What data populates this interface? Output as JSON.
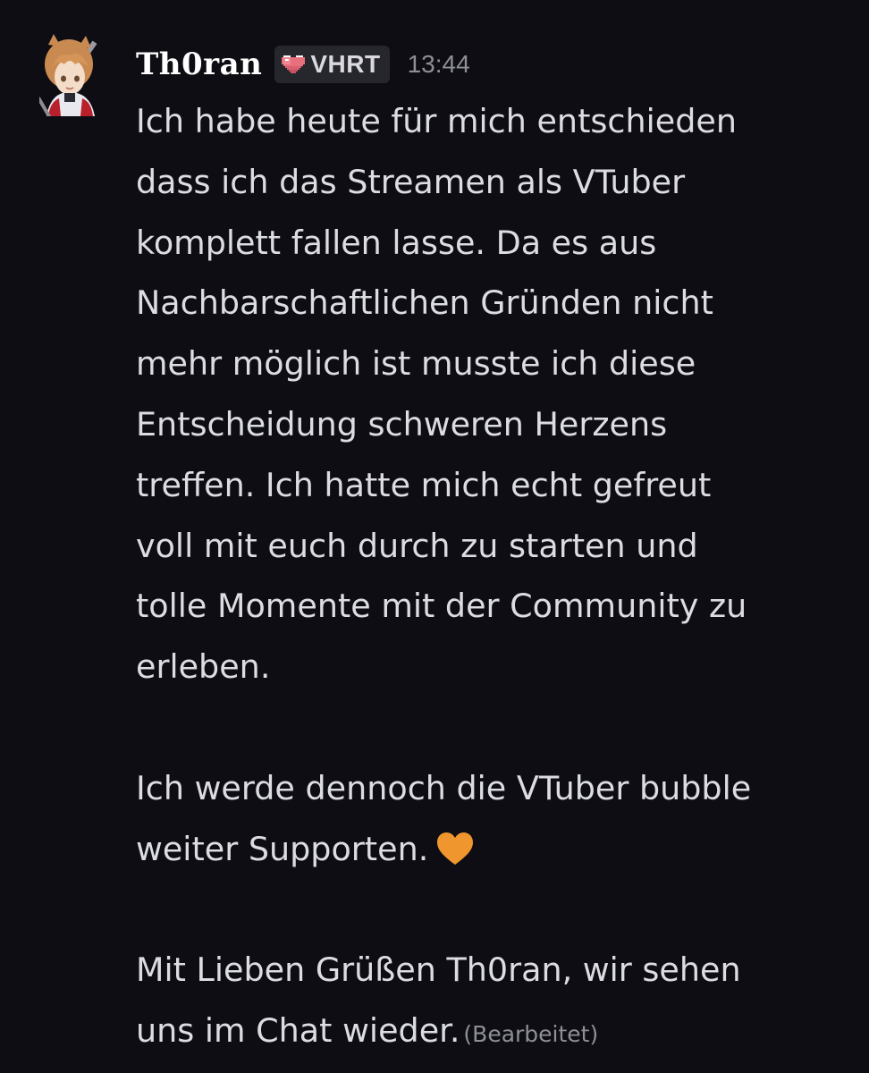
{
  "message": {
    "author": "Th0ran",
    "tag": "VHRT",
    "timestamp": "13:44",
    "paragraphs": [
      {
        "lines": [
          "Ich habe heute für mich entschieden",
          "dass ich das Streamen als VTuber",
          "komplett fallen lasse. Da es aus",
          "Nachbarschaftlichen Gründen nicht",
          "mehr möglich ist musste ich diese",
          "Entscheidung schweren Herzens",
          "treffen. Ich hatte mich echt gefreut",
          "voll mit euch durch zu starten und",
          "tolle Momente mit der Community zu",
          "erleben."
        ]
      },
      {
        "lines": [
          "Ich werde dennoch die VTuber bubble",
          "weiter Supporten."
        ],
        "emoji": "orange-heart"
      },
      {
        "lines": [
          "Mit Lieben Grüßen Th0ran,  wir sehen",
          "uns im Chat wieder."
        ]
      }
    ],
    "edited_label": "(Bearbeitet)"
  },
  "icons": {
    "tag_icon": "pixel-heart-icon",
    "emoji": "orange-heart-icon"
  },
  "colors": {
    "background": "#0d0d13",
    "text": "#dcdde1",
    "muted": "#8e8f97",
    "tag_bg": "#26262d",
    "emoji_heart": "#f0962e",
    "tag_heart": "#e8707c"
  }
}
